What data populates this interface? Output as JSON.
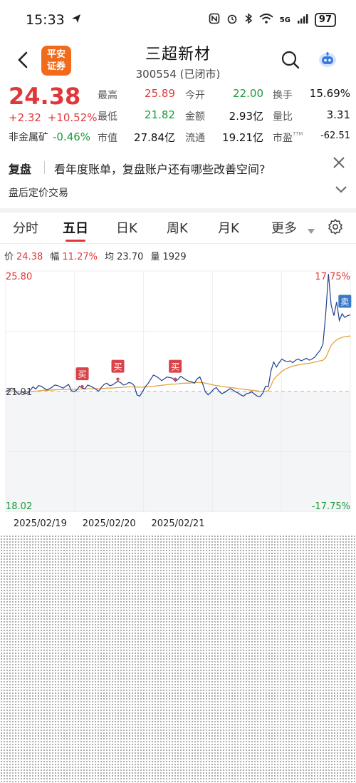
{
  "status_bar": {
    "time": "15:33",
    "battery": "97",
    "network": "5G"
  },
  "header": {
    "logo_line1": "平安",
    "logo_line2": "证券",
    "stock_name": "三超新材",
    "stock_code": "300554",
    "market_status": "(已闭市)"
  },
  "quote": {
    "price": "24.38",
    "change": "+2.32",
    "change_pct": "+10.52%",
    "sector_label": "非金属矿",
    "sector_change": "-0.46%",
    "fields": [
      {
        "label": "最高",
        "value": "25.89",
        "tone": "red"
      },
      {
        "label": "今开",
        "value": "22.00",
        "tone": "green"
      },
      {
        "label": "换手",
        "value": "15.69%",
        "tone": "dark"
      },
      {
        "label": "最低",
        "value": "21.82",
        "tone": "green"
      },
      {
        "label": "金额",
        "value": "2.93亿",
        "tone": "dark"
      },
      {
        "label": "量比",
        "value": "3.31",
        "tone": "dark"
      },
      {
        "label": "市值",
        "value": "27.84亿",
        "tone": "dark"
      },
      {
        "label": "流通",
        "value": "19.21亿",
        "tone": "dark"
      },
      {
        "label": "市盈",
        "value": "-62.51",
        "tone": "dark"
      }
    ],
    "pe_suffix": "TTM"
  },
  "banner": {
    "tag": "复盘",
    "text": "看年度账单，复盘账户还有哪些改善空间?",
    "after_hours": "盘后定价交易"
  },
  "tabs": [
    {
      "label": "分时",
      "active": false
    },
    {
      "label": "五日",
      "active": true
    },
    {
      "label": "日K",
      "active": false
    },
    {
      "label": "周K",
      "active": false
    },
    {
      "label": "月K",
      "active": false
    },
    {
      "label": "更多",
      "active": false
    }
  ],
  "chart_info": {
    "price_label": "价",
    "price": "24.38",
    "amp_label": "幅",
    "amp": "11.27%",
    "avg_label": "均",
    "avg": "23.70",
    "vol_label": "量",
    "vol": "1929"
  },
  "colors": {
    "up": "#e0383a",
    "down": "#1a9b3a",
    "price_line": "#1f3f8f",
    "avg_line": "#e8a23a",
    "sell_marker": "#3a78c9"
  },
  "chart_data": {
    "type": "line",
    "title": "",
    "ylim": [
      18.02,
      25.8
    ],
    "y_left_ticks": [
      "25.80",
      "21.91",
      "18.02"
    ],
    "y_right_ticks": [
      "17.75%",
      "-17.75%"
    ],
    "prev_close": 21.91,
    "x_day_labels": [
      "2025/02/19",
      "2025/02/20",
      "2025/02/21",
      "",
      ""
    ],
    "days": 5,
    "price_series": {
      "name": "价",
      "values": [
        21.91,
        21.95,
        22.02,
        21.98,
        21.88,
        21.82,
        21.9,
        21.84,
        21.86,
        21.96,
        22.06,
        21.99,
        22.1,
        22.08,
        22.02,
        21.96,
        22.0,
        22.05,
        22.12,
        22.1,
        22.06,
        22.02,
        22.08,
        22.14,
        21.94,
        21.9,
        21.96,
        22.08,
        22.02,
        22.0,
        22.12,
        22.08,
        22.04,
        21.98,
        21.92,
        22.04,
        22.14,
        22.18,
        22.1,
        22.12,
        22.18,
        22.24,
        22.2,
        22.12,
        22.14,
        22.2,
        22.18,
        22.1,
        21.8,
        21.76,
        21.9,
        22.06,
        22.16,
        22.3,
        22.44,
        22.4,
        22.34,
        22.26,
        22.32,
        22.38,
        22.36,
        22.34,
        22.24,
        22.3,
        22.4,
        22.34,
        22.28,
        22.24,
        22.22,
        22.18,
        22.32,
        22.38,
        22.16,
        21.9,
        21.8,
        21.88,
        21.98,
        22.04,
        21.92,
        21.84,
        21.88,
        21.94,
        22.0,
        21.96,
        21.9,
        21.86,
        21.8,
        21.76,
        21.84,
        21.86,
        21.9,
        21.82,
        21.76,
        21.74,
        21.86,
        22.08,
        22.06,
        22.58,
        22.86,
        22.7,
        22.84,
        22.96,
        22.9,
        22.88,
        22.9,
        22.84,
        22.92,
        22.96,
        22.9,
        22.94,
        22.98,
        22.92,
        22.96,
        23.02,
        23.14,
        23.24,
        23.44,
        24.4,
        25.7,
        24.7,
        24.36,
        24.8,
        24.2,
        24.42,
        24.3,
        24.36,
        24.38
      ]
    },
    "avg_series": {
      "name": "均",
      "values": [
        21.91,
        21.92,
        21.93,
        21.93,
        21.92,
        21.91,
        21.91,
        21.9,
        21.9,
        21.9,
        21.91,
        21.92,
        21.93,
        21.94,
        21.95,
        21.95,
        21.95,
        21.96,
        21.96,
        21.97,
        21.97,
        21.97,
        21.98,
        21.98,
        21.98,
        21.98,
        21.98,
        21.99,
        21.99,
        21.99,
        22.0,
        22.0,
        22.0,
        22.0,
        22.0,
        22.01,
        22.01,
        22.02,
        22.02,
        22.02,
        22.03,
        22.04,
        22.04,
        22.05,
        22.05,
        22.06,
        22.06,
        22.06,
        22.05,
        22.05,
        22.05,
        22.05,
        22.06,
        22.07,
        22.08,
        22.09,
        22.1,
        22.11,
        22.12,
        22.13,
        22.14,
        22.15,
        22.15,
        22.16,
        22.17,
        22.18,
        22.18,
        22.18,
        22.19,
        22.19,
        22.2,
        22.2,
        22.2,
        22.18,
        22.16,
        22.14,
        22.12,
        22.1,
        22.09,
        22.07,
        22.06,
        22.05,
        22.04,
        22.03,
        22.02,
        22.0,
        21.99,
        21.98,
        21.97,
        21.96,
        21.95,
        21.94,
        21.93,
        21.92,
        21.92,
        21.92,
        21.93,
        22.1,
        22.3,
        22.4,
        22.48,
        22.56,
        22.62,
        22.66,
        22.7,
        22.73,
        22.75,
        22.77,
        22.78,
        22.8,
        22.81,
        22.82,
        22.84,
        22.86,
        22.88,
        22.9,
        22.92,
        23.0,
        23.2,
        23.4,
        23.5,
        23.58,
        23.62,
        23.66,
        23.68,
        23.69,
        23.7
      ]
    },
    "markers": [
      {
        "label": "买",
        "kind": "buy",
        "index": 28,
        "value": 22.0
      },
      {
        "label": "买",
        "kind": "buy",
        "index": 41,
        "value": 22.24
      },
      {
        "label": "买",
        "kind": "buy",
        "index": 62,
        "value": 22.24
      },
      {
        "label": "卖",
        "kind": "sell",
        "index": 124,
        "value": 24.8
      }
    ]
  }
}
